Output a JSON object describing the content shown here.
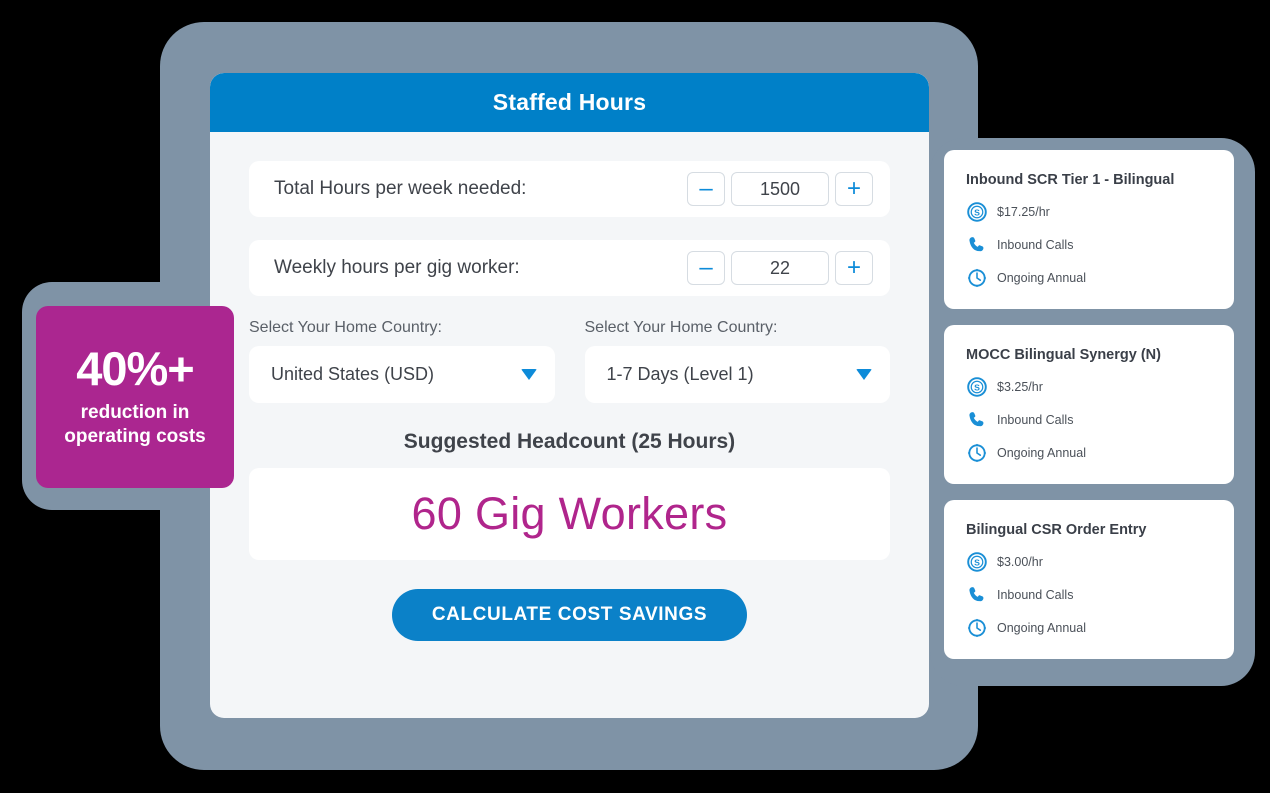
{
  "theme": {
    "accent_blue": "#0080c8",
    "magenta": "#ab2690",
    "panel_bg": "#f4f6f8",
    "frame_grey": "#7f93a6"
  },
  "panel": {
    "header_title": "Staffed Hours",
    "steppers": [
      {
        "label": "Total Hours per week needed:",
        "value": "1500",
        "minus": "–",
        "plus": "+"
      },
      {
        "label": "Weekly hours per gig worker:",
        "value": "22",
        "minus": "–",
        "plus": "+"
      }
    ],
    "selects": [
      {
        "label": "Select Your Home Country:",
        "value": "United States (USD)"
      },
      {
        "label": "Select Your Home Country:",
        "value": "1-7 Days (Level 1)"
      }
    ],
    "headcount": {
      "title": "Suggested Headcount (25 Hours)",
      "value": "60 Gig Workers"
    },
    "cta_label": "CALCULATE COST SAVINGS"
  },
  "badge": {
    "headline": "40%+",
    "line1": "reduction in",
    "line2": "operating costs"
  },
  "service_cards": [
    {
      "title": "Inbound SCR Tier 1 - Bilingual",
      "rate": "$17.25/hr",
      "channel": "Inbound Calls",
      "term": "Ongoing Annual"
    },
    {
      "title": "MOCC Bilingual Synergy (N)",
      "rate": "$3.25/hr",
      "channel": "Inbound Calls",
      "term": "Ongoing Annual"
    },
    {
      "title": "Bilingual CSR Order Entry",
      "rate": "$3.00/hr",
      "channel": "Inbound Calls",
      "term": "Ongoing Annual"
    }
  ]
}
